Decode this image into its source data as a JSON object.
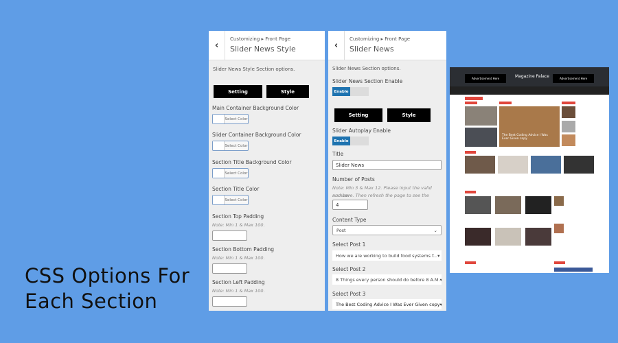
{
  "headline": {
    "line1": "CSS Options For",
    "line2": "Each Section"
  },
  "style_panel": {
    "breadcrumb": "Customizing ▸ Front Page",
    "title": "Slider News Style",
    "description": "Slider News Style Section options.",
    "setting_label": "Setting",
    "style_label": "Style",
    "select_color": "Select Color",
    "colors": [
      "Main Container Background Color",
      "Slider Container Background Color",
      "Section Title Background Color",
      "Section Title Color"
    ],
    "paddings": [
      "Section Top Padding",
      "Section Bottom Padding",
      "Section Left Padding"
    ],
    "padding_note": "Note: Min 1 & Max 100."
  },
  "settings_panel": {
    "breadcrumb": "Customizing ▸ Front Page",
    "title": "Slider News",
    "description": "Slider News Section options.",
    "enable_label": "Slider News Section Enable",
    "toggle_label": "Enable",
    "setting_label": "Setting",
    "style_label": "Style",
    "autoplay_label": "Slider Autoplay Enable",
    "title_label": "Title",
    "title_value": "Slider News",
    "posts_label": "Number of Posts",
    "posts_note1": "Note: Min 3 & Max 12. Please input the valid number",
    "posts_note2": "and save. Then refresh the page to see the change.",
    "posts_value": "4",
    "content_type_label": "Content Type",
    "content_type_value": "Post",
    "post1_label": "Select Post 1",
    "post1_value": "How we are working to build food systems f...",
    "post2_label": "Select Post 2",
    "post2_value": "8 Things every person should do before 8 A.M.",
    "post3_label": "Select Post 3",
    "post3_value": "The Best Coding Advice I Was Ever Given copy"
  },
  "preview": {
    "site_title": "Magazine Palace",
    "ad_text": "Advertisement Here",
    "featured_title": "The Best Coding Advice I Was Ever Given copy"
  },
  "colors": {
    "background": "#5f9de6",
    "toggle_blue": "#1e73b0",
    "accent_red": "#e0463c"
  }
}
